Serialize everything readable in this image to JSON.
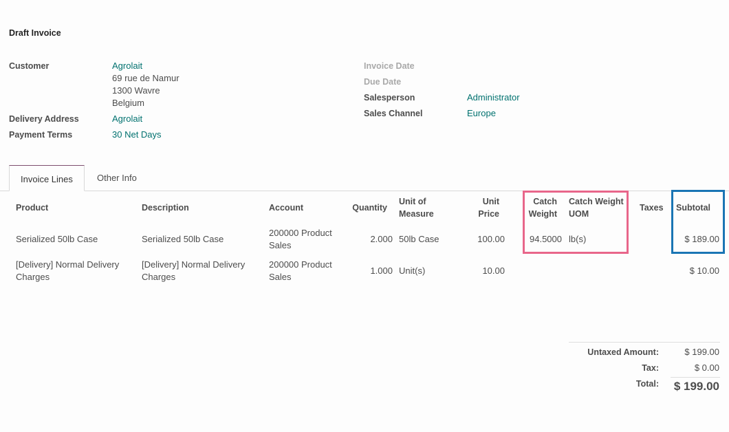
{
  "header": {
    "title": "Draft Invoice"
  },
  "left_fields": {
    "customer": {
      "label": "Customer",
      "name": "Agrolait",
      "address": [
        "69 rue de Namur",
        "1300 Wavre",
        "Belgium"
      ]
    },
    "delivery_address": {
      "label": "Delivery Address",
      "value": "Agrolait"
    },
    "payment_terms": {
      "label": "Payment Terms",
      "value": "30 Net Days"
    }
  },
  "right_fields": {
    "invoice_date": {
      "label": "Invoice Date",
      "value": ""
    },
    "due_date": {
      "label": "Due Date",
      "value": ""
    },
    "salesperson": {
      "label": "Salesperson",
      "value": "Administrator"
    },
    "sales_channel": {
      "label": "Sales Channel",
      "value": "Europe"
    }
  },
  "tabs": [
    {
      "label": "Invoice Lines",
      "active": true
    },
    {
      "label": "Other Info",
      "active": false
    }
  ],
  "table": {
    "columns": {
      "product": "Product",
      "description": "Description",
      "account": "Account",
      "quantity": "Quantity",
      "uom": [
        "Unit of",
        "Measure"
      ],
      "unit_price": [
        "Unit",
        "Price"
      ],
      "catch_weight": [
        "Catch",
        "Weight"
      ],
      "catch_weight_uom": [
        "Catch Weight",
        "UOM"
      ],
      "taxes": "Taxes",
      "subtotal": "Subtotal"
    },
    "rows": [
      {
        "product": [
          "Serialized 50lb Case"
        ],
        "description": [
          "Serialized 50lb Case"
        ],
        "account": [
          "200000 Product",
          "Sales"
        ],
        "quantity": "2.000",
        "uom": "50lb Case",
        "unit_price": "100.00",
        "catch_weight": "94.5000",
        "catch_weight_uom": "lb(s)",
        "taxes": "",
        "subtotal": "$ 189.00"
      },
      {
        "product": [
          "[Delivery] Normal Delivery",
          "Charges"
        ],
        "description": [
          "[Delivery] Normal Delivery",
          "Charges"
        ],
        "account": [
          "200000 Product",
          "Sales"
        ],
        "quantity": "1.000",
        "uom": "Unit(s)",
        "unit_price": "10.00",
        "catch_weight": "",
        "catch_weight_uom": "",
        "taxes": "",
        "subtotal": "$ 10.00"
      }
    ]
  },
  "totals": {
    "untaxed": {
      "label": "Untaxed Amount:",
      "value": "$ 199.00"
    },
    "tax": {
      "label": "Tax:",
      "value": "$ 0.00"
    },
    "total": {
      "label": "Total:",
      "value": "$ 199.00"
    }
  },
  "highlight_colors": {
    "catch_weight_box": "#e8668a",
    "subtotal_box": "#1a75b4"
  }
}
